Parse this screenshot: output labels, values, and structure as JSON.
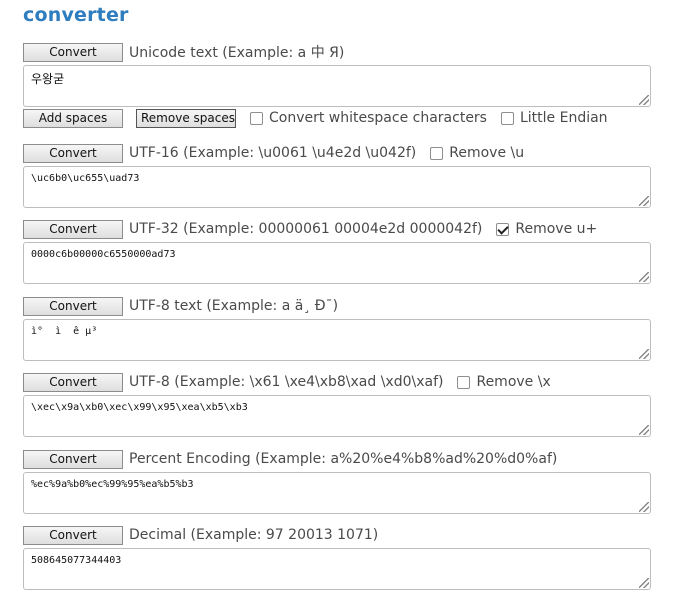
{
  "title": "converter",
  "unicode": {
    "convert_label": "Convert",
    "label": "Unicode text (Example: a 中 Я)",
    "value": "우왕굳"
  },
  "spaces": {
    "add_label": "Add spaces",
    "remove_label": "Remove spaces",
    "convert_whitespace_label": "Convert whitespace characters",
    "convert_whitespace_checked": false,
    "little_endian_label": "Little Endian",
    "little_endian_checked": false
  },
  "utf16": {
    "convert_label": "Convert",
    "label": "UTF-16 (Example: \\u0061 \\u4e2d \\u042f)",
    "option_label": "Remove \\u",
    "option_checked": false,
    "value": "\\uc6b0\\uc655\\uad73"
  },
  "utf32": {
    "convert_label": "Convert",
    "label": "UTF-32 (Example: 00000061 00004e2d 0000042f)",
    "option_label": "Remove u+",
    "option_checked": true,
    "value": "0000c6b00000c6550000ad73"
  },
  "utf8text": {
    "convert_label": "Convert",
    "label": "UTF-8 text (Example: a ä¸ Ð¯)",
    "value": "ì°  ì  ê µ³"
  },
  "utf8": {
    "convert_label": "Convert",
    "label": "UTF-8 (Example: \\x61 \\xe4\\xb8\\xad \\xd0\\xaf)",
    "option_label": "Remove \\x",
    "option_checked": false,
    "value": "\\xec\\x9a\\xb0\\xec\\x99\\x95\\xea\\xb5\\xb3"
  },
  "percent": {
    "convert_label": "Convert",
    "label": "Percent Encoding (Example: a%20%e4%b8%ad%20%d0%af)",
    "value": "%ec%9a%b0%ec%99%95%ea%b5%b3"
  },
  "decimal": {
    "convert_label": "Convert",
    "label": "Decimal (Example: 97 20013 1071)",
    "value": "508645077344403"
  }
}
